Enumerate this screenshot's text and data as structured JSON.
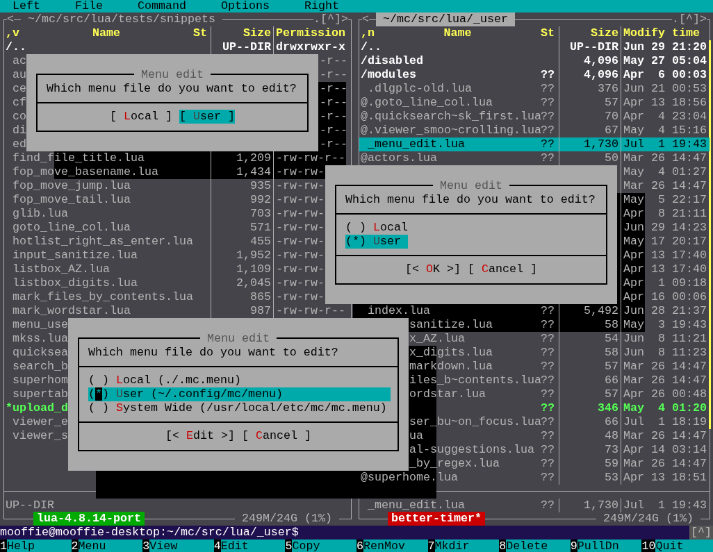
{
  "menu_bar": [
    "Left",
    "File",
    "Command",
    "Options",
    "Right"
  ],
  "left_panel": {
    "history": "<",
    "path": "~/mc/src/lua/tests/snippets",
    "controls": ".[^]>",
    "active": false,
    "columns": [
      ",v",
      "Name",
      "St",
      "Size",
      "Permission"
    ],
    "rows": [
      {
        "prefix": "/",
        "name": "..",
        "size": "UP--DIR",
        "perm": "drwxrwxr-x",
        "kind": "dir",
        "selected": false
      },
      {
        "name": "ac",
        "perm": "-r--",
        "perm_start_hidden": true,
        "kind": "file",
        "selected": false
      },
      {
        "name": "au",
        "perm": "-r--",
        "perm_start_hidden": true,
        "kind": "file",
        "selected": false
      },
      {
        "name": "ce",
        "perm": "-r--",
        "perm_start_hidden": true,
        "kind": "file",
        "selected": false
      },
      {
        "name": "cf",
        "perm": "-r--",
        "perm_start_hidden": true,
        "kind": "file",
        "selected": false
      },
      {
        "name": "co",
        "perm": "-r--",
        "perm_start_hidden": true,
        "kind": "file",
        "selected": false
      },
      {
        "name": "di",
        "perm": "-r--",
        "perm_start_hidden": true,
        "kind": "file",
        "selected": false
      },
      {
        "name": "ed",
        "perm": "-r--",
        "perm_start_hidden": true,
        "kind": "file",
        "selected": false
      },
      {
        "name": "find_file_title.lua",
        "size": "1,209",
        "perm": "-rw-rw-r--",
        "kind": "file",
        "selected": false
      },
      {
        "name": "fop_move_basename.lua",
        "size": "1,434",
        "perm": "-rw-rw-",
        "kind": "file",
        "selected": false
      },
      {
        "name": "fop_move_jump.lua",
        "size": "935",
        "perm": "-rw-rw-",
        "kind": "file",
        "selected": false
      },
      {
        "name": "fop_move_tail.lua",
        "size": "992",
        "perm": "-rw-rw-",
        "kind": "file",
        "selected": false
      },
      {
        "name": "glib.lua",
        "size": "703",
        "perm": "-rw-rw-",
        "kind": "file",
        "selected": false
      },
      {
        "name": "goto_line_col.lua",
        "size": "571",
        "perm": "-rw-rw-",
        "kind": "file",
        "selected": false
      },
      {
        "name": "hotlist_right_as_enter.lua",
        "size": "455",
        "perm": "-rw-rw-",
        "kind": "file",
        "selected": false
      },
      {
        "name": "input_sanitize.lua",
        "size": "1,952",
        "perm": "-rw-rw-",
        "kind": "file",
        "selected": false
      },
      {
        "name": "listbox_AZ.lua",
        "size": "1,109",
        "perm": "-rw-rw-",
        "kind": "file",
        "selected": false
      },
      {
        "name": "listbox_digits.lua",
        "size": "2,045",
        "perm": "-rw-rw-",
        "kind": "file",
        "selected": false
      },
      {
        "name": "mark_files_by_contents.lua",
        "size": "865",
        "perm": "-rw-rw-",
        "kind": "file",
        "selected": false
      },
      {
        "name": "mark_wordstar.lua",
        "size": "987",
        "perm": "-rw-rw-r--",
        "kind": "file",
        "selected": false
      },
      {
        "name": "menu_use",
        "kind": "file",
        "selected": false
      },
      {
        "name": "mkss.lua",
        "kind": "file",
        "selected": false
      },
      {
        "name": "quicksea",
        "kind": "file",
        "selected": false
      },
      {
        "name": "search_b",
        "kind": "file",
        "selected": false
      },
      {
        "name": "superhom",
        "kind": "file",
        "selected": false
      },
      {
        "name": "supertab",
        "kind": "file",
        "selected": false
      },
      {
        "prefix": "*",
        "name": "upload_d",
        "kind": "exe",
        "selected": false
      },
      {
        "name": "viewer_e",
        "kind": "file",
        "selected": false
      },
      {
        "name": "viewer_s",
        "kind": "file",
        "selected": false
      }
    ],
    "status": {
      "name": "UP--DIR"
    },
    "label": {
      "text": "lua-4.8.14-port",
      "color": "#00aa00"
    },
    "disk": "249M/24G (1%)"
  },
  "right_panel": {
    "history": "<",
    "path": "~/mc/src/lua/_user",
    "controls": ".[^]>",
    "active": true,
    "columns": [
      ",n",
      "Name",
      "St",
      "Size",
      "Modify time"
    ],
    "rows": [
      {
        "prefix": "/",
        "name": "..",
        "size": "UP--DIR",
        "date": "Jun 29 21:20",
        "kind": "dir",
        "selected": false
      },
      {
        "prefix": "/",
        "name": "disabled",
        "size": "4,096",
        "date": "May 27 05:04",
        "kind": "dir",
        "selected": false
      },
      {
        "prefix": "/",
        "name": "modules",
        "st": "??",
        "size": "4,096",
        "date": "Apr  6 00:03",
        "kind": "dir",
        "selected": false
      },
      {
        "name": ".dlgplc-old.lua",
        "st": "??",
        "size": "376",
        "date": "Jun 21 00:53",
        "kind": "file",
        "selected": false
      },
      {
        "prefix": "@",
        "name": ".goto_line_col.lua",
        "st": "??",
        "size": "57",
        "date": "Apr 13 18:56",
        "kind": "file",
        "selected": false
      },
      {
        "prefix": "@",
        "name": ".quicksearch~sk_first.lua",
        "st": "??",
        "size": "70",
        "date": "Apr  4 23:04",
        "kind": "file",
        "selected": false
      },
      {
        "prefix": "@",
        "name": ".viewer_smoo~crolling.lua",
        "st": "??",
        "size": "67",
        "date": "May  4 15:16",
        "kind": "file",
        "selected": false
      },
      {
        "name": "_menu_edit.lua",
        "st": "??",
        "size": "1,730",
        "date": "Jul  1 19:43",
        "kind": "file",
        "selected": true
      },
      {
        "prefix": "@",
        "name": "actors.lua",
        "st": "??",
        "size": "50",
        "date": "Mar 26 14:47",
        "kind": "file",
        "selected": false
      },
      {
        "date": "May  4 01:27",
        "kind": "file",
        "selected": false
      },
      {
        "date": "Mar 26 14:47",
        "kind": "file",
        "selected": false
      },
      {
        "date": "May  5 22:17",
        "kind": "file",
        "selected": false
      },
      {
        "date": "Apr  8 21:11",
        "kind": "file",
        "selected": false
      },
      {
        "date": "Jun 29 14:23",
        "kind": "file",
        "selected": false
      },
      {
        "date": "May 17 20:17",
        "kind": "file",
        "selected": false
      },
      {
        "date": "Apr 13 17:40",
        "kind": "file",
        "selected": false
      },
      {
        "date": "Apr 13 17:40",
        "kind": "file",
        "selected": false
      },
      {
        "date": "Apr  1 09:18",
        "kind": "file",
        "selected": false
      },
      {
        "date": "Apr 16 00:06",
        "kind": "file",
        "selected": false
      },
      {
        "name": "index.lua",
        "st": "??",
        "size": "5,492",
        "date": "Jun 28 21:37",
        "kind": "file",
        "selected": false
      },
      {
        "name": "sanitize.lua",
        "st": "??",
        "size": "58",
        "date": "May  3 19:43",
        "start_hidden": true,
        "kind": "file",
        "selected": false
      },
      {
        "name": "x_AZ.lua",
        "st": "??",
        "size": "54",
        "date": "Jun  8 11:21",
        "start_hidden": true,
        "kind": "file",
        "selected": false
      },
      {
        "name": "x_digits.lua",
        "st": "??",
        "size": "58",
        "date": "Jun  8 11:23",
        "start_hidden": true,
        "kind": "file",
        "selected": false
      },
      {
        "name": "markdown.lua",
        "st": "??",
        "size": "57",
        "date": "Mar 26 14:47",
        "start_hidden": true,
        "kind": "file",
        "selected": false
      },
      {
        "name": "iles_b~contents.lua",
        "st": "??",
        "size": "66",
        "date": "Mar 26 14:47",
        "start_hidden": true,
        "kind": "file",
        "selected": false
      },
      {
        "name": "ordstar.lua",
        "st": "??",
        "size": "57",
        "date": "Apr 26 00:48",
        "start_hidden": true,
        "kind": "file",
        "selected": false
      },
      {
        "st": "??",
        "size": "346",
        "date": "May  4 01:20",
        "kind": "exe",
        "selected": false
      },
      {
        "name": "ser_bu~on_focus.lua",
        "st": "??",
        "size": "66",
        "date": "Jul  1 18:19",
        "start_hidden": true,
        "kind": "file",
        "selected": false
      },
      {
        "name": "ua",
        "st": "??",
        "size": "48",
        "date": "Mar 26 14:47",
        "start_hidden": true,
        "kind": "file",
        "selected": false
      },
      {
        "name": "al-suggestions.lua",
        "st": "??",
        "size": "73",
        "date": "Apr 14 03:14",
        "start_hidden": true,
        "kind": "file",
        "selected": false
      },
      {
        "name": "_by_regex.lua",
        "st": "??",
        "size": "59",
        "date": "Mar 26 14:47",
        "start_hidden": true,
        "kind": "file",
        "selected": false
      },
      {
        "prefix": "@",
        "name": "superhome.lua",
        "st": "??",
        "size": "53",
        "date": "Apr 13 18:51",
        "kind": "file",
        "selected": false
      }
    ],
    "status": {
      "name": "_menu_edit.lua",
      "st": "??",
      "size": "1,730",
      "date": "Jul  1 19:43"
    },
    "label": {
      "text": "better-timer*",
      "color": "#cc0000"
    },
    "disk": "249M/24G (1%)"
  },
  "dialogs": [
    {
      "title": "Menu edit",
      "question": "Which menu file do you want to edit?",
      "focused": false,
      "buttons": [
        {
          "left": "[ ",
          "hotkey": "L",
          "text": "ocal",
          "right": " ]",
          "selected": false
        },
        {
          "left": "[ ",
          "hotkey": "U",
          "text": "ser",
          "right": " ]",
          "selected": true
        }
      ]
    },
    {
      "title": "Menu edit",
      "question": "Which menu file do you want to edit?",
      "focused": false,
      "options": [
        {
          "mark": "( )",
          "hotkey": "L",
          "text": "ocal",
          "selected": false
        },
        {
          "mark": "(*)",
          "hotkey": "U",
          "text": "ser",
          "selected": true
        }
      ],
      "buttons": [
        {
          "left": "[< ",
          "hotkey": "O",
          "text": "K",
          "right": " >]",
          "selected": false
        },
        {
          "left": "[ ",
          "hotkey": "C",
          "text": "ancel",
          "right": " ]",
          "selected": false
        }
      ]
    },
    {
      "title": "Menu edit",
      "question": "Which menu file do you want to edit?",
      "focused": true,
      "options": [
        {
          "mark": "( )",
          "hotkey": "L",
          "text": "ocal (./.mc.menu)",
          "selected": false
        },
        {
          "mark": "(*)",
          "hotkey": "U",
          "text": "ser (~/.config/mc/menu)",
          "selected": true
        },
        {
          "mark": "( )",
          "hotkey": "S",
          "text": "ystem Wide (/usr/local/etc/mc/mc.menu)",
          "selected": false
        }
      ],
      "buttons": [
        {
          "left": "[< ",
          "hotkey": "E",
          "text": "dit",
          "right": " >]",
          "selected": false
        },
        {
          "left": "[ ",
          "hotkey": "C",
          "text": "ancel",
          "right": " ]",
          "selected": false
        }
      ]
    }
  ],
  "command_line": {
    "prompt": "mooffie@mooffie-desktop:~/mc/src/lua/_user$",
    "history": "[^]"
  },
  "function_keys": [
    {
      "number": "1",
      "label": "Help"
    },
    {
      "number": "2",
      "label": "Menu"
    },
    {
      "number": "3",
      "label": "View"
    },
    {
      "number": "4",
      "label": "Edit"
    },
    {
      "number": "5",
      "label": "Copy"
    },
    {
      "number": "6",
      "label": "RenMov"
    },
    {
      "number": "7",
      "label": "Mkdir"
    },
    {
      "number": "8",
      "label": "Delete"
    },
    {
      "number": "9",
      "label": "PullDn"
    },
    {
      "number": "10",
      "label": "Quit"
    }
  ]
}
